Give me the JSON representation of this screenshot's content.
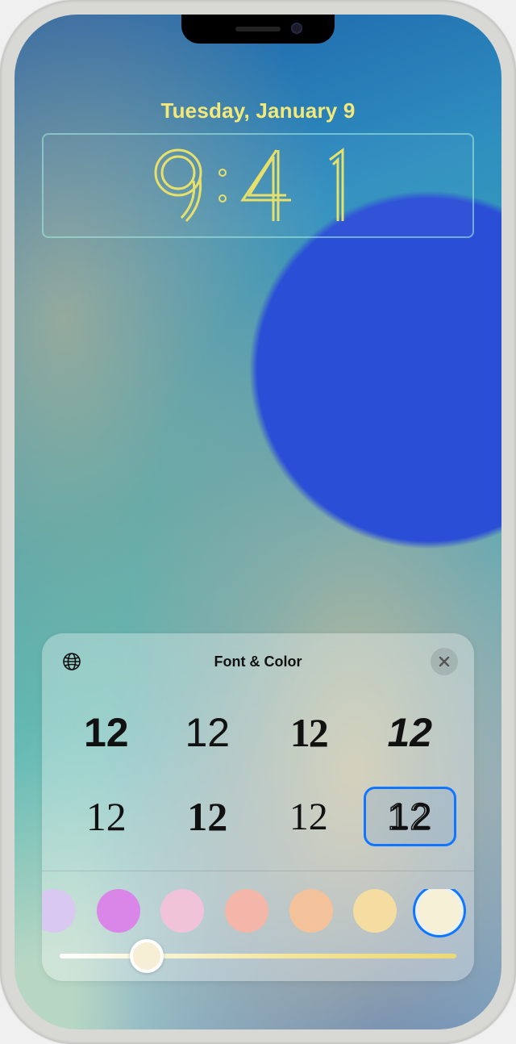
{
  "lockscreen": {
    "date": "Tuesday, January 9",
    "time": "9:41"
  },
  "panel": {
    "title": "Font & Color",
    "globe_icon": "globe-icon",
    "close_icon": "close-icon",
    "fonts": [
      {
        "sample": "12",
        "style": "f1",
        "selected": false
      },
      {
        "sample": "12",
        "style": "f2",
        "selected": false
      },
      {
        "sample": "12",
        "style": "f3",
        "selected": false
      },
      {
        "sample": "12",
        "style": "f4",
        "selected": false
      },
      {
        "sample": "12",
        "style": "f5",
        "selected": false
      },
      {
        "sample": "12",
        "style": "f6",
        "selected": false
      },
      {
        "sample": "12",
        "style": "f7",
        "selected": false
      },
      {
        "sample": "12",
        "style": "f8",
        "selected": true
      }
    ],
    "colors": [
      {
        "hex": "#d9c9f0",
        "selected": false,
        "cut": true
      },
      {
        "hex": "#d986e8",
        "selected": false,
        "cut": false
      },
      {
        "hex": "#f0c3d9",
        "selected": false,
        "cut": false
      },
      {
        "hex": "#f3b6a8",
        "selected": false,
        "cut": false
      },
      {
        "hex": "#f4c29a",
        "selected": false,
        "cut": false
      },
      {
        "hex": "#f5dca0",
        "selected": false,
        "cut": false
      },
      {
        "hex": "#f6f0d6",
        "selected": true,
        "cut": false
      }
    ],
    "slider": {
      "value": 22,
      "min": 0,
      "max": 100
    }
  }
}
